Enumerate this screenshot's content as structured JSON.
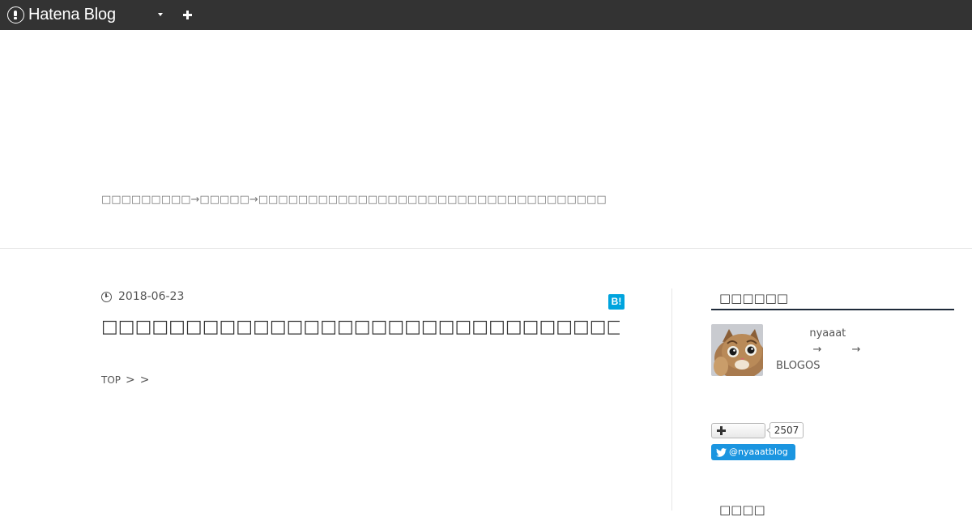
{
  "topbar": {
    "logo_text": "Hatena Blog"
  },
  "header": {
    "description": "□□□□□□□□□→□□□□□→□□□□□□□□□□□□□□□□□□□□□□□□□□□□□□□□□□□"
  },
  "entry": {
    "date": "2018-06-23",
    "hatebu_label": "B!",
    "title": "□□□□□□□□□□□□□□□□□□□□□□□□□□□□□□□□□□□",
    "breadcrumb": {
      "top": "TOP",
      "sep1": ">",
      "sep2": ">"
    }
  },
  "sidebar": {
    "profile_heading": "□□□□□□",
    "profile_lines": [
      "          nyaaat",
      "           →         →",
      "BLOGOS"
    ],
    "follow_count": "2507",
    "twitter_handle": "@nyaaatblog",
    "next_heading": "□□□□"
  },
  "colors": {
    "topbar": "#333333",
    "hatebu": "#00a4de",
    "twitter": "#1b95e0",
    "heading_rule": "#1e2a3a"
  }
}
